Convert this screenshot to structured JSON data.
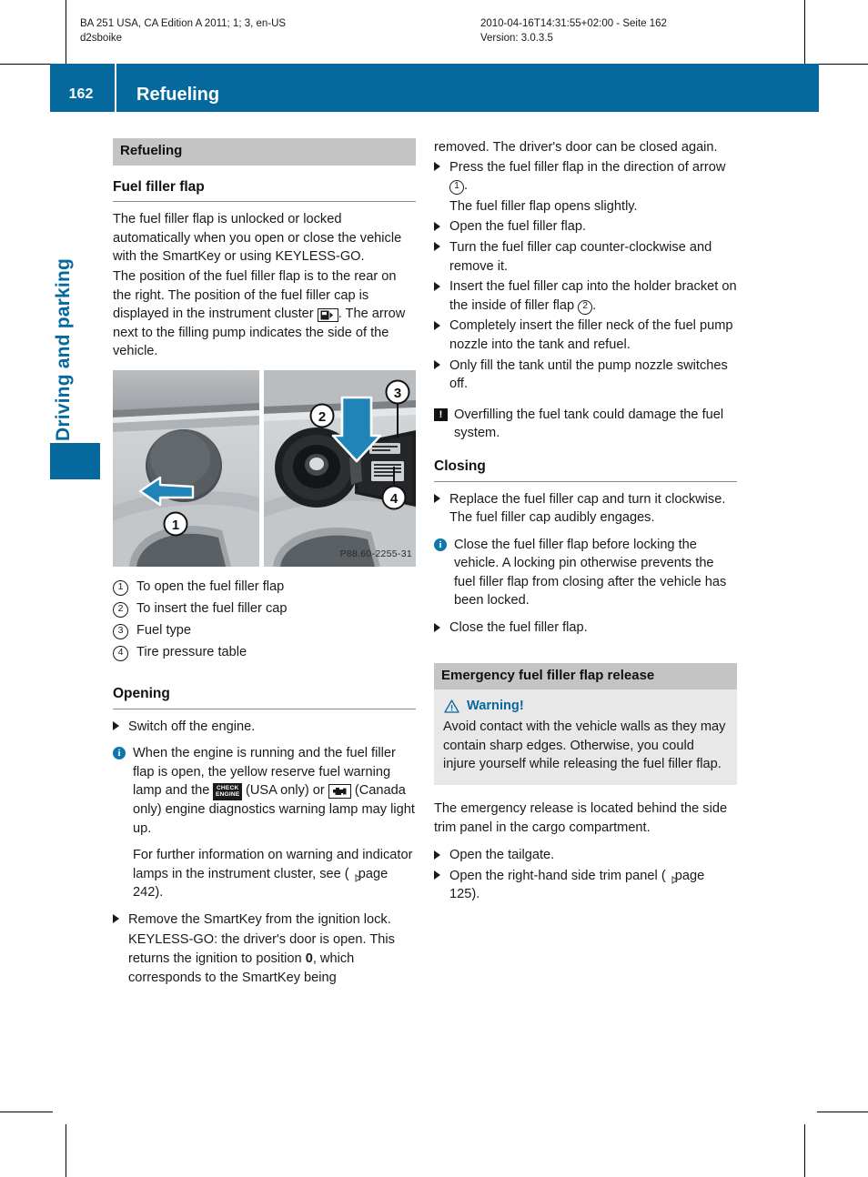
{
  "print_header": {
    "line1": "BA 251 USA, CA Edition A 2011; 1; 3, en-US",
    "line2": "d2sboike",
    "line3": "2010-04-16T14:31:55+02:00 - Seite 162",
    "line4": "Version: 3.0.3.5"
  },
  "banner": {
    "page_number": "162",
    "title": "Refueling",
    "color": "#06699e"
  },
  "chapter_tab": {
    "label": "Driving and parking",
    "color": "#06699e"
  },
  "left_column": {
    "section_heading": "Refueling",
    "sub_heading": "Fuel filler flap",
    "para1": "The fuel filler flap is unlocked or locked automatically when you open or close the vehicle with the SmartKey or using KEYLESS-GO.",
    "para2_a": "The position of the fuel filler flap is to the rear on the right. The position of the fuel filler cap is displayed in the instrument cluster",
    "para2_b": ". The arrow next to the filling pump indicates the side of the vehicle.",
    "figure": {
      "caption_code": "P88.60-2255-31",
      "alt_left": "fuel-filler-flap-closed-photo",
      "alt_right": "fuel-filler-flap-open-photo"
    },
    "legend": [
      {
        "num": "1",
        "text": "To open the fuel filler flap"
      },
      {
        "num": "2",
        "text": "To insert the fuel filler cap"
      },
      {
        "num": "3",
        "text": "Fuel type"
      },
      {
        "num": "4",
        "text": "Tire pressure table"
      }
    ],
    "opening_heading": "Opening",
    "step1": "Switch off the engine.",
    "note1_a": "When the engine is running and the fuel filler flap is open, the yellow reserve fuel warning lamp and the",
    "note1_check_engine_line1": "CHECK",
    "note1_check_engine_line2": "ENGINE",
    "note1_b": "(USA only) or",
    "note1_c": "(Canada only) engine diagnostics warning lamp may light up.",
    "note1_d_a": "For further information on warning and indicator lamps in the instrument cluster, see (",
    "note1_d_page": "page 242",
    "note1_d_b": ").",
    "step2": "Remove the SmartKey from the ignition lock.",
    "step2_sub_a": "KEYLESS-GO: the driver's door is open. This returns the ignition to position ",
    "step2_sub_bold": "0",
    "step2_sub_b": ", which corresponds to the SmartKey being"
  },
  "right_column": {
    "cont_para": "removed. The driver's door can be closed again.",
    "step1_a": "Press the fuel filler flap in the direction of arrow",
    "step1_num": "1",
    "step1_b": ".",
    "step1_sub": "The fuel filler flap opens slightly.",
    "step2": "Open the fuel filler flap.",
    "step3": "Turn the fuel filler cap counter-clockwise and remove it.",
    "step4_a": "Insert the fuel filler cap into the holder bracket on the inside of filler flap",
    "step4_num": "2",
    "step4_b": ".",
    "step5": "Completely insert the filler neck of the fuel pump nozzle into the tank and refuel.",
    "step6": "Only fill the tank until the pump nozzle switches off.",
    "caution": "Overfilling the fuel tank could damage the fuel system.",
    "closing_heading": "Closing",
    "closing_step1": "Replace the fuel filler cap and turn it clockwise. The fuel filler cap audibly engages.",
    "closing_note": "Close the fuel filler flap before locking the vehicle. A locking pin otherwise prevents the fuel filler flap from closing after the vehicle has been locked.",
    "closing_step2": "Close the fuel filler flap.",
    "emergency_heading": "Emergency fuel filler flap release",
    "warning_title": "Warning!",
    "warning_text": "Avoid contact with the vehicle walls as they may contain sharp edges. Otherwise, you could injure yourself while releasing the fuel filler flap.",
    "emergency_para": "The emergency release is located behind the side trim panel in the cargo compartment.",
    "emergency_step1": "Open the tailgate.",
    "emergency_step2_a": "Open the right-hand side trim panel (",
    "emergency_step2_page": "page 125",
    "emergency_step2_b": ")."
  },
  "icons": {
    "fuel_pump": "fuel-pump-indicator-icon",
    "check_engine": "check-engine-icon",
    "engine_diagnostics": "engine-diagnostics-icon",
    "info": "info-icon",
    "caution": "caution-icon",
    "warning_triangle": "warning-triangle-icon",
    "xref": "cross-reference-arrow-icon"
  }
}
